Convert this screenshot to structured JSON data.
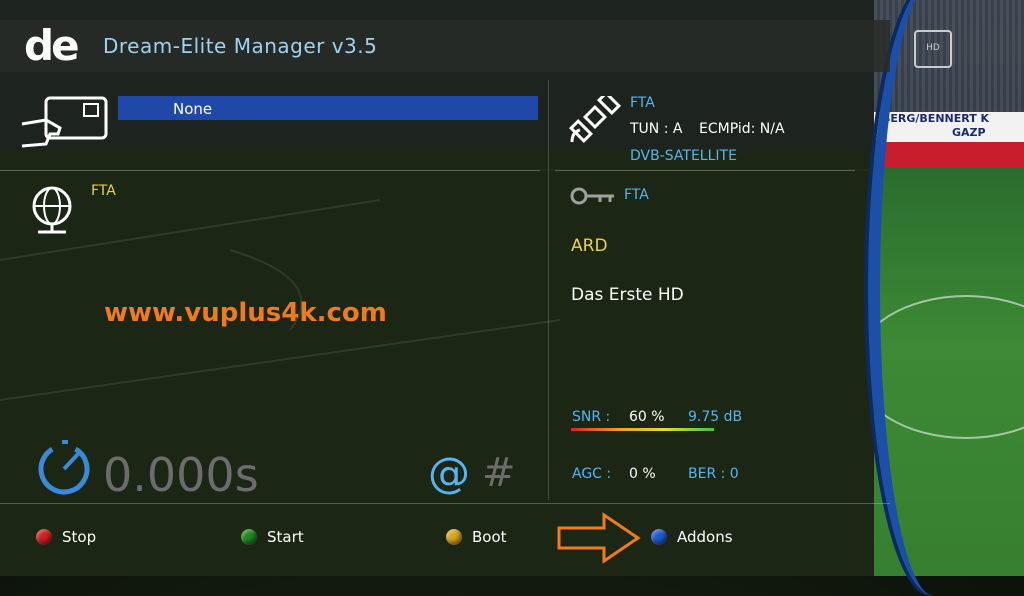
{
  "header": {
    "logo_text": "de",
    "title": "Dream-Elite Manager v3.5"
  },
  "cam": {
    "selected": "None",
    "type": "FTA"
  },
  "watermark": "www.vuplus4k.com",
  "satellite": {
    "encryption": "FTA",
    "tuner_label": "TUN : A",
    "ecm_label": "ECMPid: N/A",
    "system": "DVB-SATELLITE"
  },
  "key": {
    "status": "FTA"
  },
  "service": {
    "provider": "ARD",
    "channel": "Das Erste HD"
  },
  "signal": {
    "snr_label": "SNR :",
    "snr_percent": "60 %",
    "snr_db": "9.75 dB",
    "agc_label": "AGC :",
    "agc_value": "0 %",
    "ber_label": "BER : 0"
  },
  "timer": {
    "value": "0.000s"
  },
  "symbols": {
    "at": "@",
    "hash": "#"
  },
  "buttons": {
    "red": {
      "label": "Stop",
      "color": "#d21e1e"
    },
    "green": {
      "label": "Start",
      "color": "#1e8a1e"
    },
    "yellow": {
      "label": "Boot",
      "color": "#d8a81e"
    },
    "blue": {
      "label": "Addons",
      "color": "#1e5ad2"
    }
  },
  "live": {
    "board_text": "BERG/BENNERT K",
    "board_text2": "GAZP",
    "channel_logo": "HD"
  }
}
